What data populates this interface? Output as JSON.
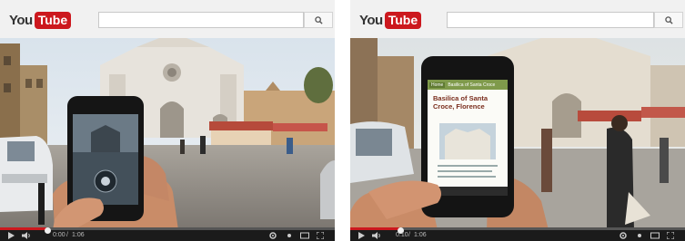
{
  "players": [
    {
      "logo": {
        "you": "You",
        "tube": "Tube"
      },
      "search": {
        "icon": "search-icon"
      },
      "progress": 0.14,
      "time": {
        "current": "0:00",
        "total": "1:06"
      },
      "icons": [
        "play-icon",
        "volume-icon",
        "settings-icon",
        "cc-icon",
        "theater-icon",
        "fullscreen-icon"
      ]
    },
    {
      "logo": {
        "you": "You",
        "tube": "Tube"
      },
      "search": {
        "icon": "search-icon"
      },
      "progress": 0.15,
      "time": {
        "current": "0:10",
        "total": "1:06"
      },
      "phone_screen": {
        "nav_back": "Home",
        "nav_title": "Basilica of Santa Croce",
        "article_title": "Basilica of Santa Croce, Florence"
      },
      "icons": [
        "play-icon",
        "volume-icon",
        "settings-icon",
        "cc-icon",
        "theater-icon",
        "fullscreen-icon"
      ]
    }
  ],
  "colors": {
    "brand_red": "#cc181e",
    "header_bg": "#f1f1f1"
  }
}
